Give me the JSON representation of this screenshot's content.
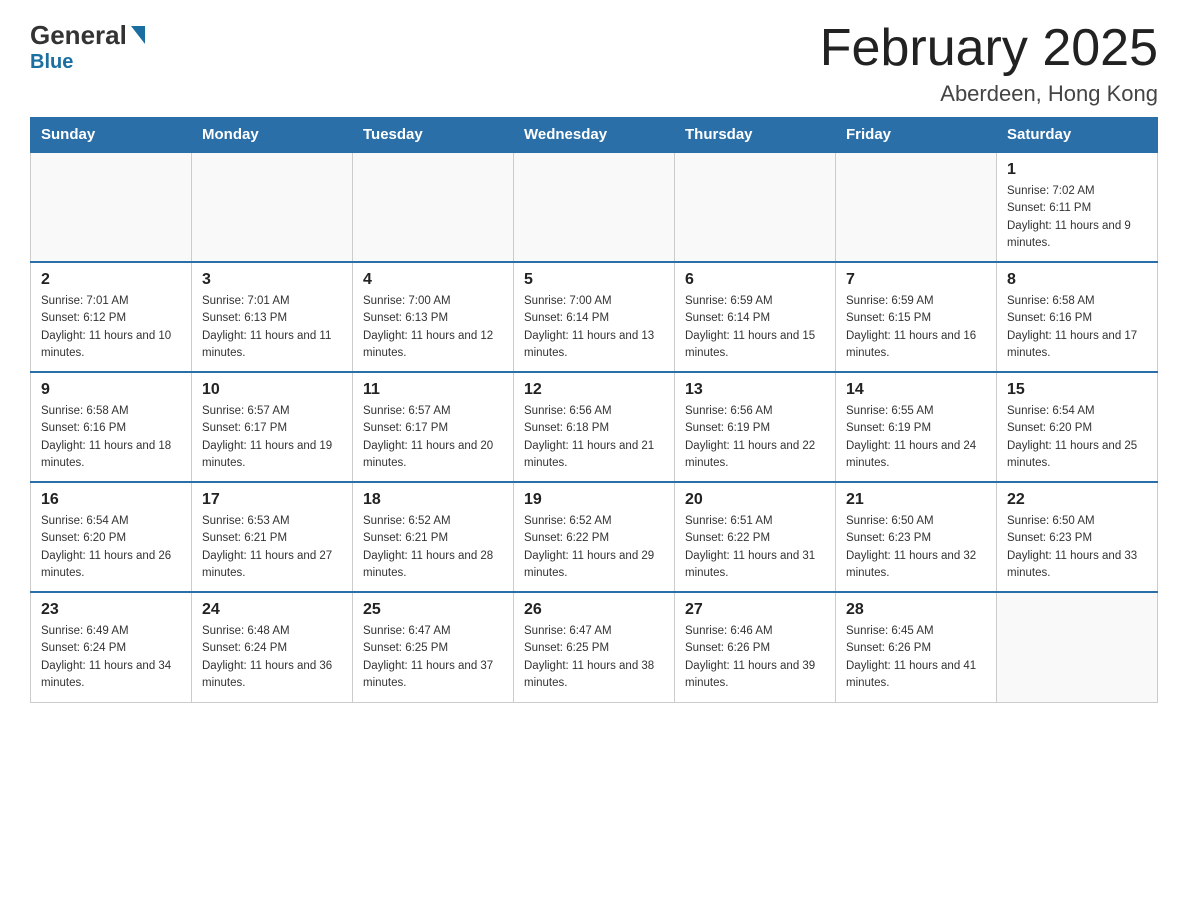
{
  "logo": {
    "general": "General",
    "blue": "Blue"
  },
  "header": {
    "title": "February 2025",
    "location": "Aberdeen, Hong Kong"
  },
  "weekdays": [
    "Sunday",
    "Monday",
    "Tuesday",
    "Wednesday",
    "Thursday",
    "Friday",
    "Saturday"
  ],
  "weeks": [
    [
      {
        "day": "",
        "empty": true
      },
      {
        "day": "",
        "empty": true
      },
      {
        "day": "",
        "empty": true
      },
      {
        "day": "",
        "empty": true
      },
      {
        "day": "",
        "empty": true
      },
      {
        "day": "",
        "empty": true
      },
      {
        "day": "1",
        "sunrise": "7:02 AM",
        "sunset": "6:11 PM",
        "daylight": "11 hours and 9 minutes."
      }
    ],
    [
      {
        "day": "2",
        "sunrise": "7:01 AM",
        "sunset": "6:12 PM",
        "daylight": "11 hours and 10 minutes."
      },
      {
        "day": "3",
        "sunrise": "7:01 AM",
        "sunset": "6:13 PM",
        "daylight": "11 hours and 11 minutes."
      },
      {
        "day": "4",
        "sunrise": "7:00 AM",
        "sunset": "6:13 PM",
        "daylight": "11 hours and 12 minutes."
      },
      {
        "day": "5",
        "sunrise": "7:00 AM",
        "sunset": "6:14 PM",
        "daylight": "11 hours and 13 minutes."
      },
      {
        "day": "6",
        "sunrise": "6:59 AM",
        "sunset": "6:14 PM",
        "daylight": "11 hours and 15 minutes."
      },
      {
        "day": "7",
        "sunrise": "6:59 AM",
        "sunset": "6:15 PM",
        "daylight": "11 hours and 16 minutes."
      },
      {
        "day": "8",
        "sunrise": "6:58 AM",
        "sunset": "6:16 PM",
        "daylight": "11 hours and 17 minutes."
      }
    ],
    [
      {
        "day": "9",
        "sunrise": "6:58 AM",
        "sunset": "6:16 PM",
        "daylight": "11 hours and 18 minutes."
      },
      {
        "day": "10",
        "sunrise": "6:57 AM",
        "sunset": "6:17 PM",
        "daylight": "11 hours and 19 minutes."
      },
      {
        "day": "11",
        "sunrise": "6:57 AM",
        "sunset": "6:17 PM",
        "daylight": "11 hours and 20 minutes."
      },
      {
        "day": "12",
        "sunrise": "6:56 AM",
        "sunset": "6:18 PM",
        "daylight": "11 hours and 21 minutes."
      },
      {
        "day": "13",
        "sunrise": "6:56 AM",
        "sunset": "6:19 PM",
        "daylight": "11 hours and 22 minutes."
      },
      {
        "day": "14",
        "sunrise": "6:55 AM",
        "sunset": "6:19 PM",
        "daylight": "11 hours and 24 minutes."
      },
      {
        "day": "15",
        "sunrise": "6:54 AM",
        "sunset": "6:20 PM",
        "daylight": "11 hours and 25 minutes."
      }
    ],
    [
      {
        "day": "16",
        "sunrise": "6:54 AM",
        "sunset": "6:20 PM",
        "daylight": "11 hours and 26 minutes."
      },
      {
        "day": "17",
        "sunrise": "6:53 AM",
        "sunset": "6:21 PM",
        "daylight": "11 hours and 27 minutes."
      },
      {
        "day": "18",
        "sunrise": "6:52 AM",
        "sunset": "6:21 PM",
        "daylight": "11 hours and 28 minutes."
      },
      {
        "day": "19",
        "sunrise": "6:52 AM",
        "sunset": "6:22 PM",
        "daylight": "11 hours and 29 minutes."
      },
      {
        "day": "20",
        "sunrise": "6:51 AM",
        "sunset": "6:22 PM",
        "daylight": "11 hours and 31 minutes."
      },
      {
        "day": "21",
        "sunrise": "6:50 AM",
        "sunset": "6:23 PM",
        "daylight": "11 hours and 32 minutes."
      },
      {
        "day": "22",
        "sunrise": "6:50 AM",
        "sunset": "6:23 PM",
        "daylight": "11 hours and 33 minutes."
      }
    ],
    [
      {
        "day": "23",
        "sunrise": "6:49 AM",
        "sunset": "6:24 PM",
        "daylight": "11 hours and 34 minutes."
      },
      {
        "day": "24",
        "sunrise": "6:48 AM",
        "sunset": "6:24 PM",
        "daylight": "11 hours and 36 minutes."
      },
      {
        "day": "25",
        "sunrise": "6:47 AM",
        "sunset": "6:25 PM",
        "daylight": "11 hours and 37 minutes."
      },
      {
        "day": "26",
        "sunrise": "6:47 AM",
        "sunset": "6:25 PM",
        "daylight": "11 hours and 38 minutes."
      },
      {
        "day": "27",
        "sunrise": "6:46 AM",
        "sunset": "6:26 PM",
        "daylight": "11 hours and 39 minutes."
      },
      {
        "day": "28",
        "sunrise": "6:45 AM",
        "sunset": "6:26 PM",
        "daylight": "11 hours and 41 minutes."
      },
      {
        "day": "",
        "empty": true
      }
    ]
  ],
  "labels": {
    "sunrise": "Sunrise: ",
    "sunset": "Sunset: ",
    "daylight": "Daylight: "
  }
}
